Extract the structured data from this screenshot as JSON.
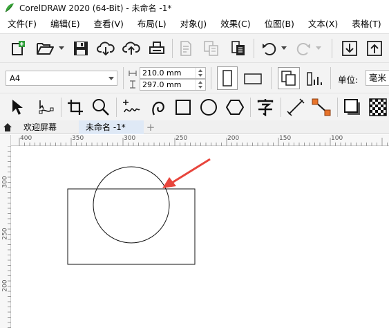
{
  "window": {
    "title": "CorelDRAW 2020 (64-Bit) - 未命名 -1*"
  },
  "menu": [
    "文件(F)",
    "编辑(E)",
    "查看(V)",
    "布局(L)",
    "对象(J)",
    "效果(C)",
    "位图(B)",
    "文本(X)",
    "表格(T)"
  ],
  "property_bar": {
    "page_size": "A4",
    "width": "210.0 mm",
    "height": "297.0 mm",
    "unit_label": "单位:",
    "unit_value": "毫米"
  },
  "tabs": {
    "welcome": "欢迎屏幕",
    "document": "未命名 -1*",
    "add": "+"
  },
  "rulers": {
    "horizontal": [
      "400",
      "350",
      "300",
      "250",
      "200",
      "150",
      "100"
    ],
    "vertical": [
      "300",
      "250",
      "200"
    ]
  },
  "colors": {
    "arrow": "#e8453c",
    "accent": "#2f7d32",
    "tab_active": "#dfe9f6"
  }
}
